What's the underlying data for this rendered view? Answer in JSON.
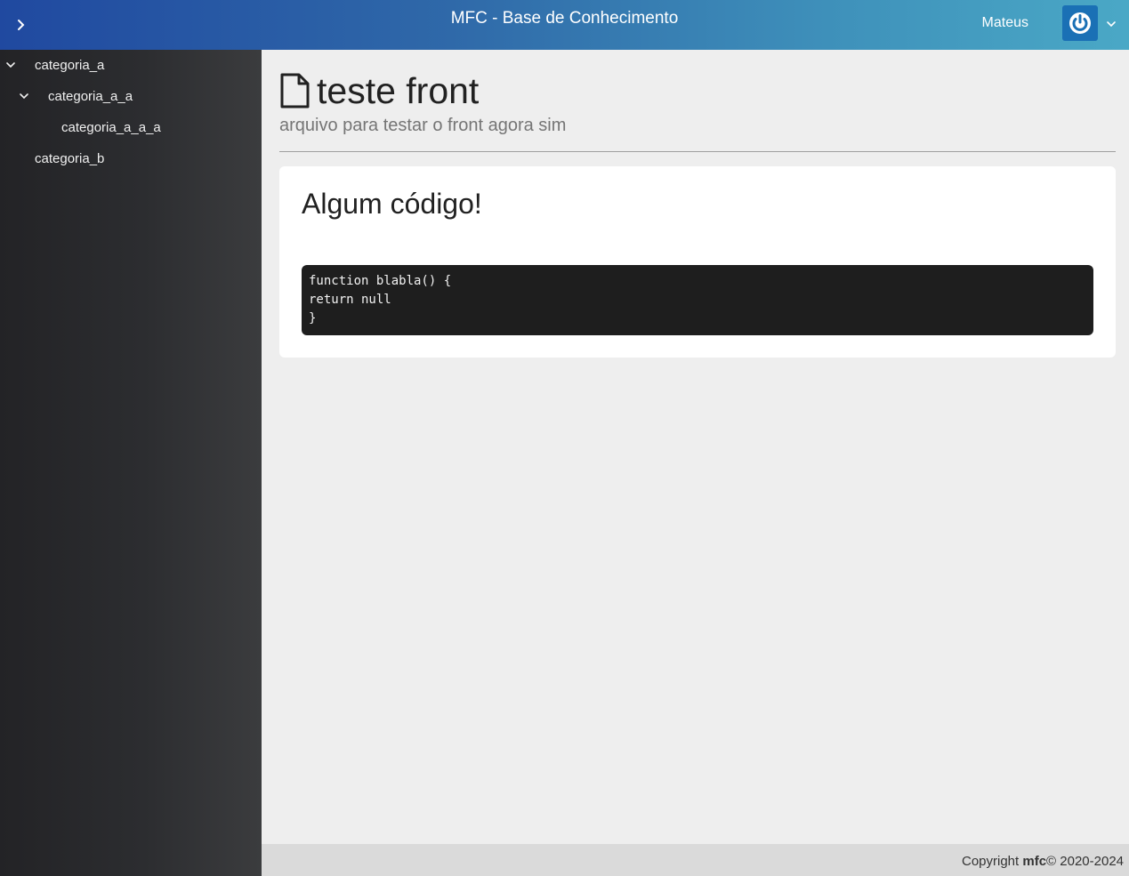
{
  "header": {
    "title": "MFC - Base de Conhecimento",
    "user_name": "Mateus"
  },
  "sidebar": {
    "items": [
      {
        "label": "categoria_a",
        "expanded": true
      },
      {
        "label": "categoria_a_a",
        "expanded": true
      },
      {
        "label": "categoria_a_a_a"
      },
      {
        "label": "categoria_b"
      }
    ]
  },
  "document": {
    "title": "teste front",
    "subtitle": "arquivo para testar o front agora sim"
  },
  "card": {
    "heading": "Algum código!",
    "code": "function blabla() {\nreturn null\n}"
  },
  "footer": {
    "prefix": "Copyright",
    "brand": "mfc",
    "suffix": "© 2020-2024"
  },
  "colors": {
    "header_start": "#2049a0",
    "header_end": "#4aa8c6",
    "sidebar_bg": "#2c2d30",
    "avatar_bg": "#1a70b5",
    "code_bg": "#1e1e1e"
  }
}
